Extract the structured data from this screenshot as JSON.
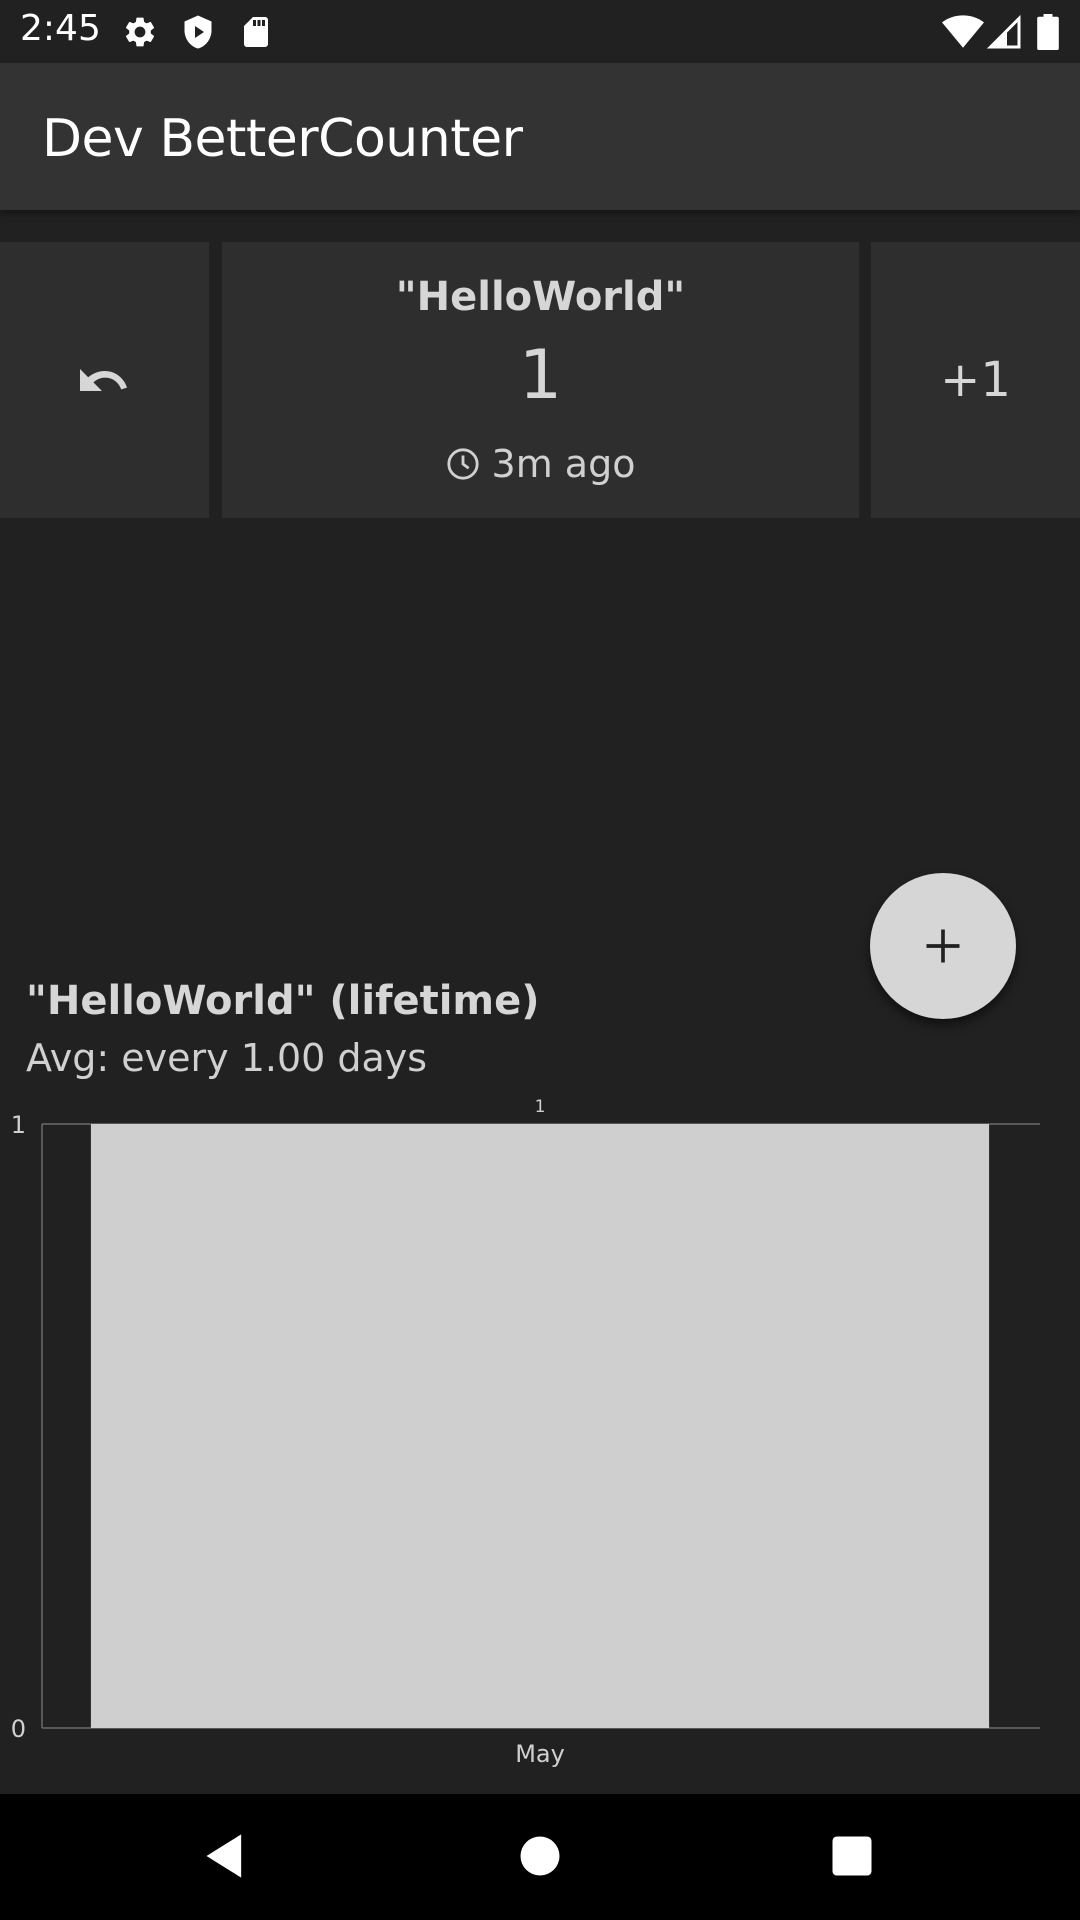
{
  "status_bar": {
    "time": "2:45",
    "left_icons": [
      "gear-icon",
      "shield-icon",
      "sd-card-icon"
    ],
    "right_icons": [
      "wifi-icon",
      "signal-icon",
      "battery-icon"
    ]
  },
  "app_bar": {
    "title": "Dev BetterCounter"
  },
  "counter": {
    "name": "\"HelloWorld\"",
    "value": "1",
    "last_time": "3m ago",
    "increment_label": "+1"
  },
  "stats": {
    "title": "\"HelloWorld\" (lifetime)",
    "average": "Avg: every 1.00 days"
  },
  "chart_data": {
    "type": "bar",
    "categories": [
      "May"
    ],
    "values": [
      1
    ],
    "value_labels": [
      "1"
    ],
    "ylim": [
      0,
      1
    ],
    "y_ticks": [
      "0",
      "1"
    ],
    "bar_color": "#cfcfcf",
    "grid": false
  },
  "colors": {
    "background": "#212121",
    "app_bar": "#333333",
    "card": "#2e2e2e",
    "fab": "#d6d6d6"
  }
}
